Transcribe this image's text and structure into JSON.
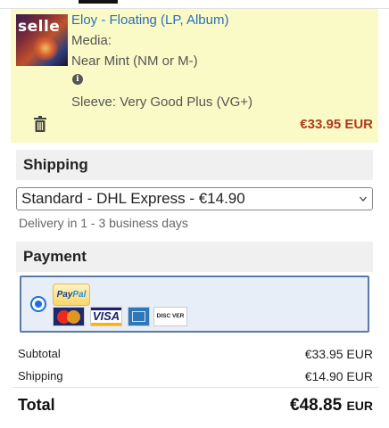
{
  "cart_item": {
    "thumbnail_watermark": "selle",
    "title": "Eloy - Floating (LP, Album)",
    "media_label": "Media:",
    "media_condition": "Near Mint (NM or M-)",
    "sleeve": "Sleeve: Very Good Plus (VG+)",
    "price": "€33.95 EUR",
    "icons": [
      "info-icon",
      "trash-icon"
    ]
  },
  "shipping": {
    "header": "Shipping",
    "selected_option": "Standard - DHL Express - €14.90",
    "delivery_text": "Delivery in 1 - 3 business days"
  },
  "payment": {
    "header": "Payment",
    "paypal_label_1": "Pay",
    "paypal_label_2": "Pal",
    "visa_label": "VISA",
    "discover_label": "DISC VER",
    "method_selected": true
  },
  "summary": {
    "subtotal_label": "Subtotal",
    "subtotal_value": "€33.95 EUR",
    "shipping_label": "Shipping",
    "shipping_value": "€14.90 EUR",
    "total_label": "Total",
    "total_amount": "€48.85",
    "total_currency": "EUR"
  },
  "colors": {
    "item_background": "#fafac6",
    "link": "#2a6ebb",
    "price": "#b03a1e",
    "payment_border": "#5b7aa6",
    "radio": "#1e6fd9"
  }
}
